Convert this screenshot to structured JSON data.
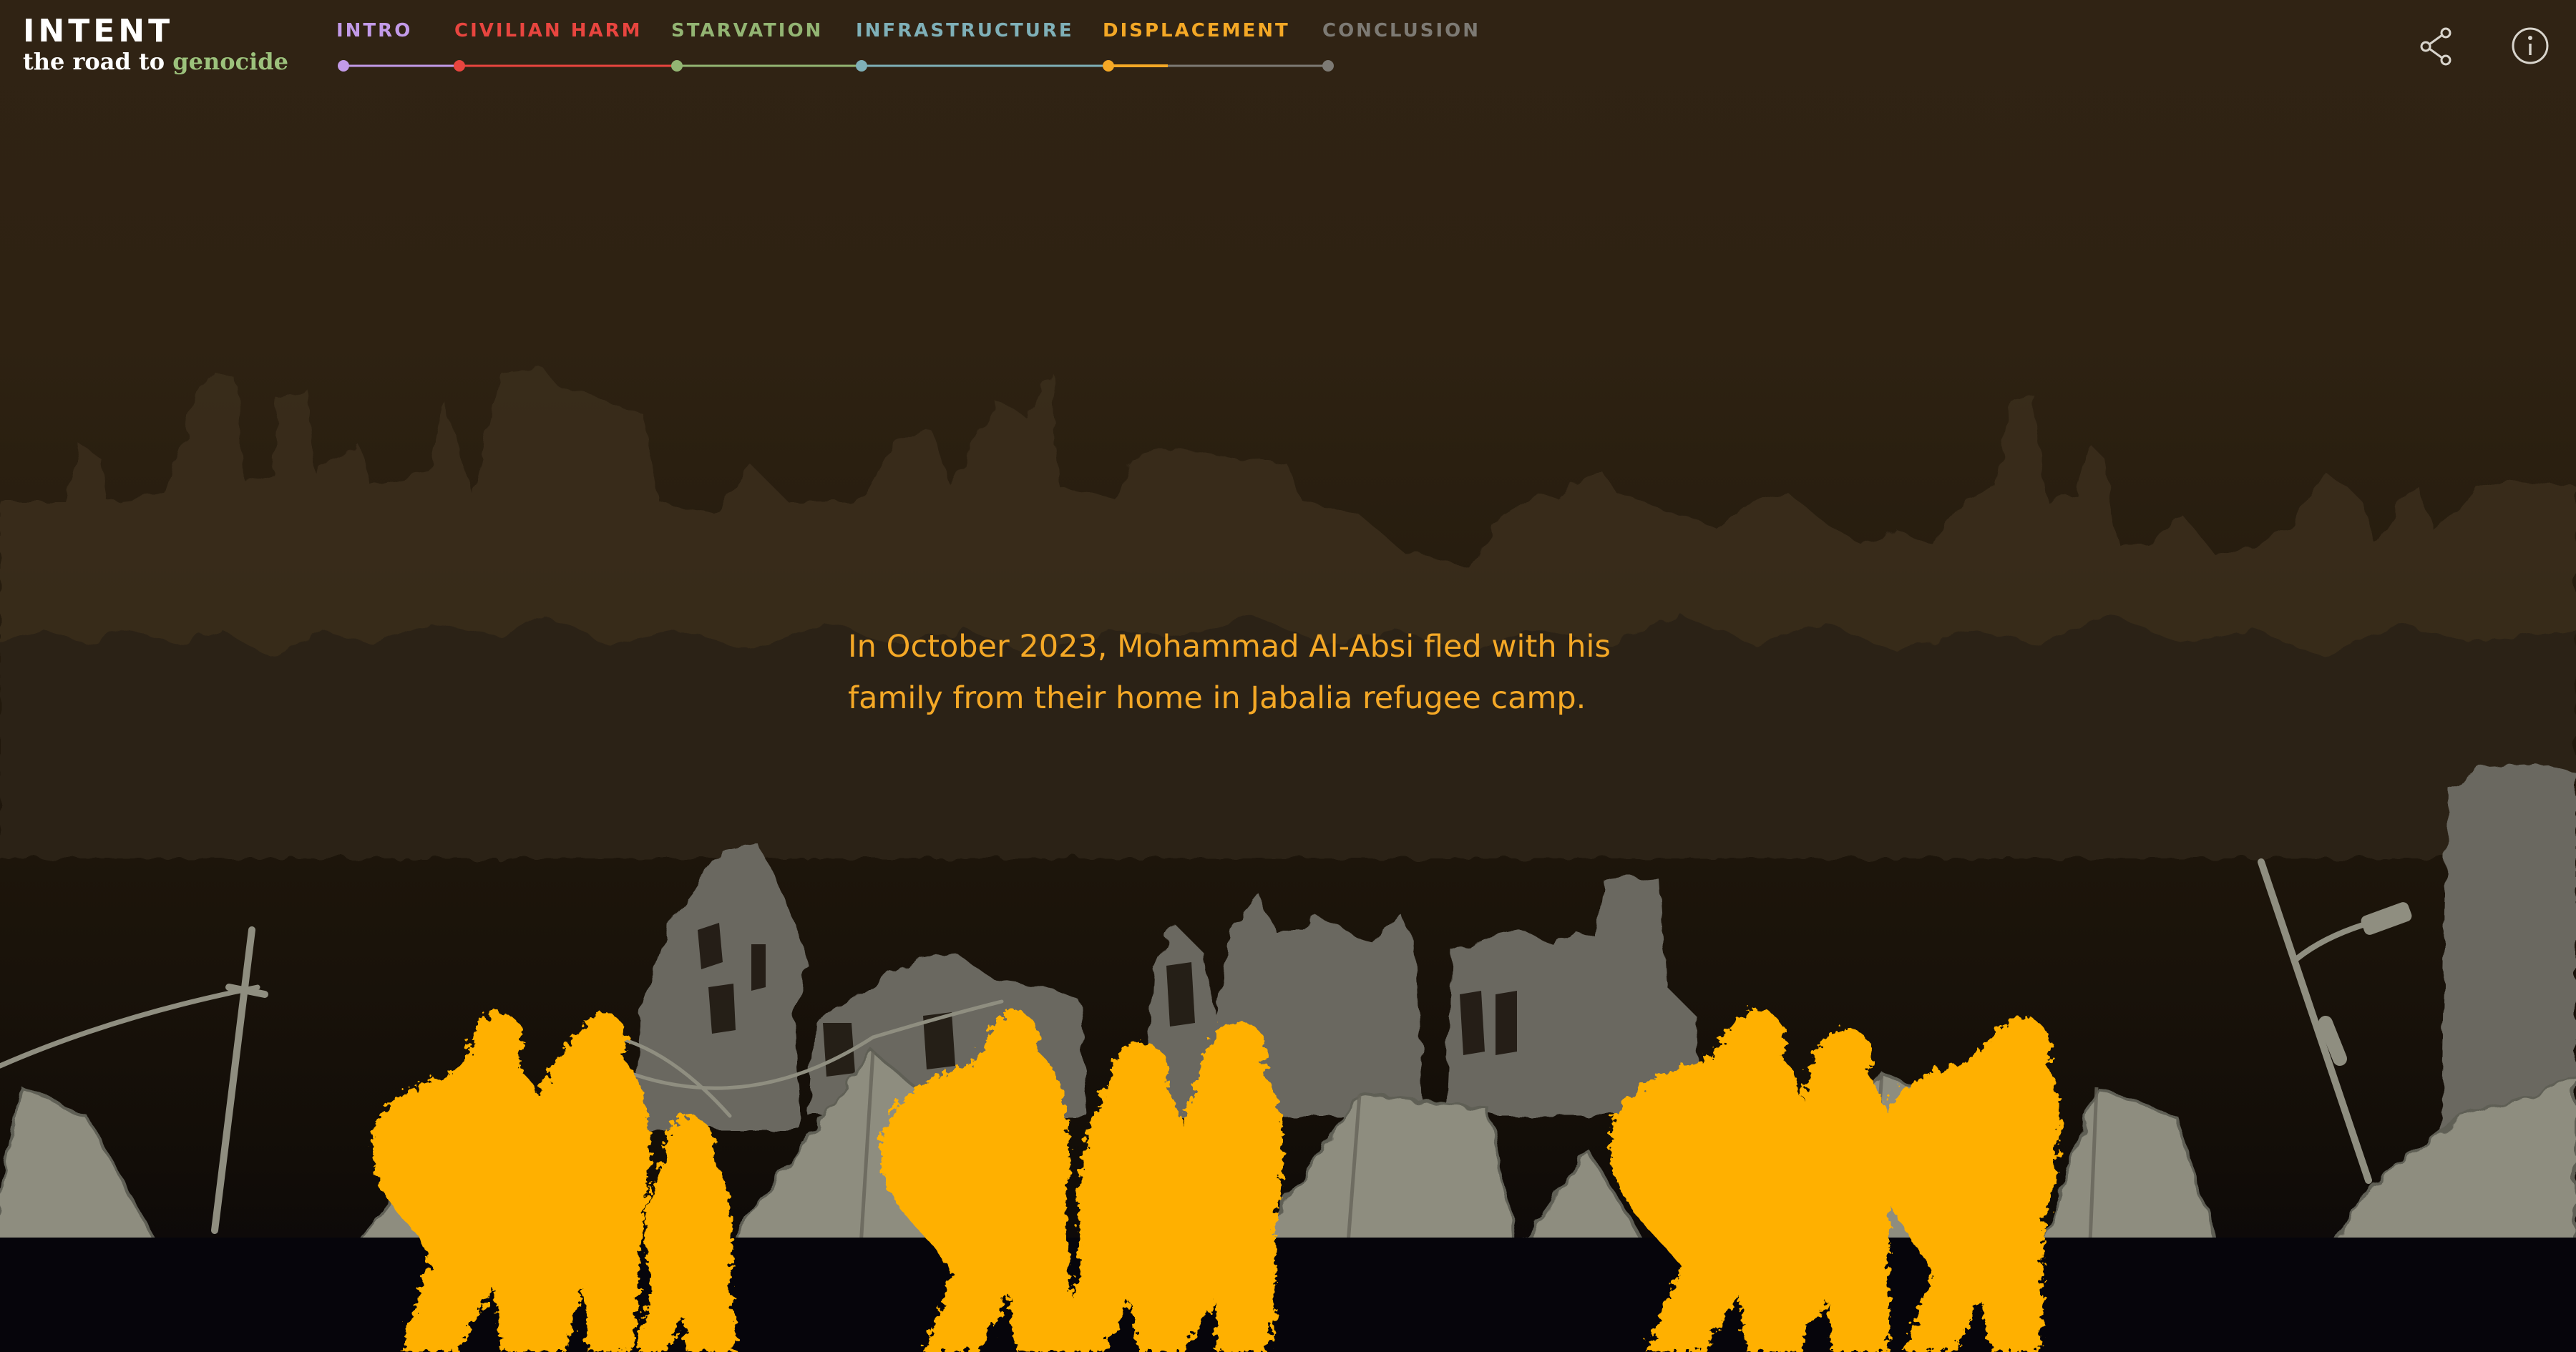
{
  "brand": {
    "title": "INTENT",
    "subtitle_prefix": "the road to ",
    "subtitle_accent": "genocide",
    "accent_color": "#9cc27c"
  },
  "nav": {
    "items": [
      {
        "label": "INTRO",
        "color": "#c29ae8",
        "state": "visited"
      },
      {
        "label": "CIVILIAN HARM",
        "color": "#e8453f",
        "state": "visited"
      },
      {
        "label": "STARVATION",
        "color": "#93b573",
        "state": "visited"
      },
      {
        "label": "INFRASTRUCTURE",
        "color": "#7fb0b8",
        "state": "visited"
      },
      {
        "label": "DISPLACEMENT",
        "color": "#f4a826",
        "state": "current"
      },
      {
        "label": "CONCLUSION",
        "color": "#7d7a74",
        "state": "upcoming"
      }
    ]
  },
  "actions": {
    "share_icon": "share-icon",
    "info_icon": "info-icon"
  },
  "story": {
    "text": "In October 2023, Mohammad Al-Absi fled with his family from their home in Jabalia refugee camp.",
    "color": "#f4a826"
  },
  "illustration": {
    "figures_color": "#ffb000",
    "ruins_color": "#6e6b64",
    "tents_color": "#8f8e80"
  }
}
